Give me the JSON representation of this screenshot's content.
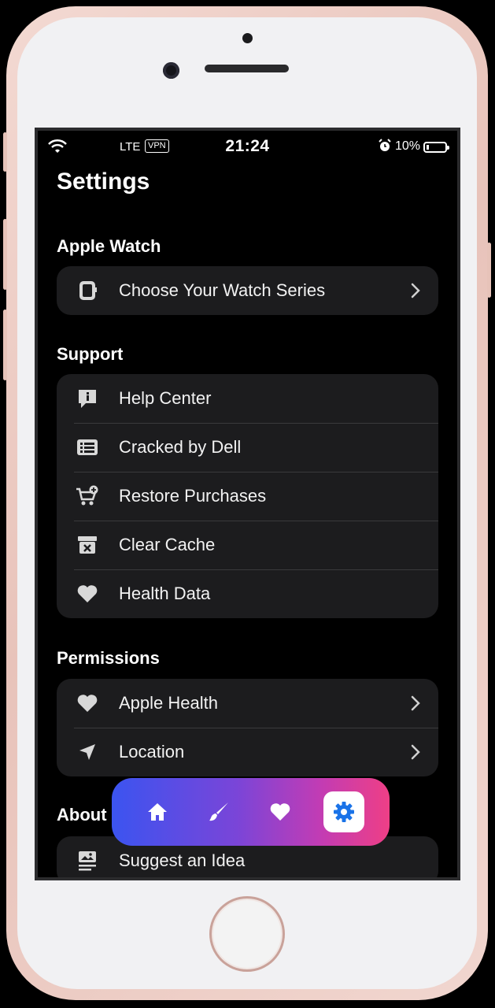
{
  "status_bar": {
    "carrier": "LTE",
    "vpn": "VPN",
    "time": "21:24",
    "battery": "10%"
  },
  "page_title": "Settings",
  "sections": {
    "apple_watch": {
      "header": "Apple Watch",
      "items": [
        {
          "label": "Choose Your Watch Series",
          "icon": "watch-icon",
          "chevron": true
        }
      ]
    },
    "support": {
      "header": "Support",
      "items": [
        {
          "label": "Help Center",
          "icon": "info-bubble-icon"
        },
        {
          "label": "Cracked by Dell",
          "icon": "list-icon"
        },
        {
          "label": "Restore Purchases",
          "icon": "cart-add-icon"
        },
        {
          "label": "Clear Cache",
          "icon": "archive-x-icon"
        },
        {
          "label": "Health Data",
          "icon": "heart-icon"
        }
      ]
    },
    "permissions": {
      "header": "Permissions",
      "items": [
        {
          "label": "Apple Health",
          "icon": "heart-icon",
          "chevron": true
        },
        {
          "label": "Location",
          "icon": "location-arrow-icon",
          "chevron": true
        }
      ]
    },
    "about": {
      "header": "About",
      "items": [
        {
          "label": "Suggest an Idea",
          "icon": "image-list-icon"
        }
      ]
    }
  },
  "tab_bar": {
    "tabs": [
      "home-icon",
      "brush-icon",
      "heart-icon",
      "gear-icon"
    ],
    "active": "gear-icon",
    "gradient": [
      "#3b54f0",
      "#ee3f86"
    ],
    "active_icon_color": "#1a73e8"
  }
}
